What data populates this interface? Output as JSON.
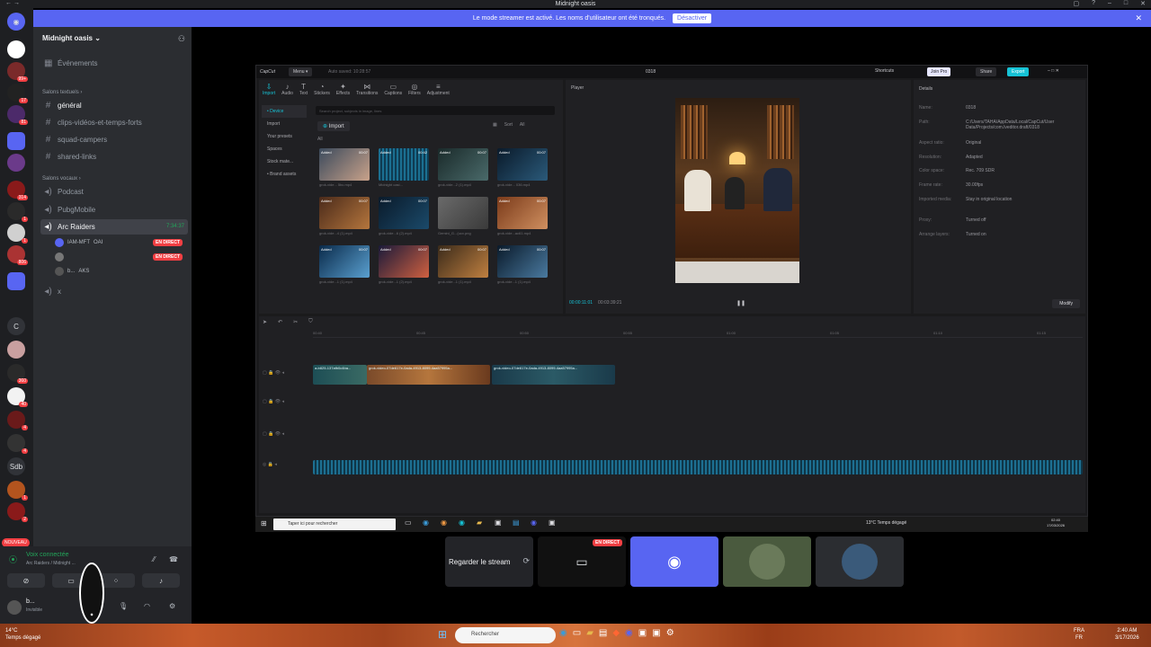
{
  "window": {
    "title": "Midnight oasis"
  },
  "banner": {
    "text": "Le mode streamer est activé. Les noms d'utilisateur ont été tronqués.",
    "button": "Désactiver"
  },
  "guilds": [
    {
      "label": "",
      "badge": ""
    },
    {
      "label": "",
      "badge": "99+"
    },
    {
      "label": "",
      "badge": "17"
    },
    {
      "label": "",
      "badge": "81"
    },
    {
      "label": "",
      "badge": ""
    },
    {
      "label": "",
      "badge": ""
    },
    {
      "label": "",
      "badge": "314"
    },
    {
      "label": "",
      "badge": "1"
    },
    {
      "label": "",
      "badge": "1"
    },
    {
      "label": "",
      "badge": "806"
    },
    {
      "label": "",
      "badge": ""
    },
    {
      "label": "C",
      "badge": ""
    },
    {
      "label": "",
      "badge": ""
    },
    {
      "label": "",
      "badge": "360"
    },
    {
      "label": "",
      "badge": "40"
    },
    {
      "label": "",
      "badge": "4"
    },
    {
      "label": "",
      "badge": "4"
    },
    {
      "label": "Sdb",
      "badge": ""
    },
    {
      "label": "",
      "badge": "1"
    },
    {
      "label": "",
      "badge": "2"
    }
  ],
  "guild_new": "NOUVEAU",
  "server": {
    "name": "Midnight oasis",
    "events": "Événements",
    "text_category": "Salons textuels",
    "text_channels": [
      "général",
      "clips-vidéos-et-temps-forts",
      "squad-campers",
      "shared-links"
    ],
    "voice_category": "Salons vocaux",
    "voice_channels": [
      "Podcast",
      "PubgMobile",
      "Arc Raiders",
      "x"
    ],
    "arc_timer": "7:34:37",
    "voice_users": [
      {
        "name": "IAM-MFT",
        "tag": "OAI",
        "live": "EN DIRECT"
      },
      {
        "name": "",
        "tag": "",
        "live": "EN DIRECT"
      },
      {
        "name": "b...",
        "tag": "AKS",
        "live": ""
      }
    ]
  },
  "voice_panel": {
    "status": "Voix connectée",
    "sub": "Arc Raiders / Midnight ...",
    "user": "b...",
    "user_status": "Invisible"
  },
  "capcut": {
    "logo": "CapCut",
    "menu": "Menu",
    "autosave": "Auto saved: 10:28:57",
    "project": "0318",
    "shortcuts": "Shortcuts",
    "join_pro": "Join Pro",
    "share": "Share",
    "export": "Export",
    "tools": [
      "Import",
      "Audio",
      "Text",
      "Stickers",
      "Effects",
      "Transitions",
      "Captions",
      "Filters",
      "Adjustment"
    ],
    "side": [
      "• Device",
      "Import",
      "Your presets",
      "Spaces",
      "Stock mate...",
      "• Brand assets"
    ],
    "search_placeholder": "Search project, subjects in image, lines",
    "import_btn": "Import",
    "all": "All",
    "sort": "Sort",
    "all2": "All",
    "thumbs": [
      {
        "tag": "Added",
        "dur": "00:07",
        "cap": "grok-vide... 5bc.mp4"
      },
      {
        "tag": "Added",
        "dur": "00:42",
        "cap": "Midnight oasi..."
      },
      {
        "tag": "Added",
        "dur": "00:07",
        "cap": "grok-vide...2 (1).mp4"
      },
      {
        "tag": "Added",
        "dur": "00:07",
        "cap": "grok-vide... 036.mp4"
      },
      {
        "tag": "Added",
        "dur": "00:07",
        "cap": "grok-vide...4 (1).mp4"
      },
      {
        "tag": "Added",
        "dur": "00:07",
        "cap": "grok-vide...6 (2).mp4"
      },
      {
        "tag": "",
        "dur": "",
        "cap": "Gemini_G...(ucx.png"
      },
      {
        "tag": "Added",
        "dur": "00:07",
        "cap": "grok-vide...ac61.mp4"
      },
      {
        "tag": "Added",
        "dur": "00:07",
        "cap": "grok-vide...1 (1).mp4"
      },
      {
        "tag": "Added",
        "dur": "00:07",
        "cap": "grok-vide...1 (2).mp4"
      },
      {
        "tag": "Added",
        "dur": "00:07",
        "cap": "grok-vide...1 (1).mp4"
      },
      {
        "tag": "Added",
        "dur": "00:07",
        "cap": "grok-vide...1 (1).mp4"
      }
    ],
    "player_title": "Player",
    "time_current": "00:00:11:01",
    "time_total": "00:03:39:21",
    "details_title": "Details",
    "details": [
      {
        "k": "Name:",
        "v": "0318"
      },
      {
        "k": "Path:",
        "v": "C:/Users/TAHA/AppData/Local/CapCut/User Data/Projects/com.lveditor.draft/0318"
      },
      {
        "k": "Aspect ratio:",
        "v": "Original"
      },
      {
        "k": "Resolution:",
        "v": "Adapted"
      },
      {
        "k": "Color space:",
        "v": "Rec. 709 SDR"
      },
      {
        "k": "Frame rate:",
        "v": "30.00fps"
      },
      {
        "k": "Imported media:",
        "v": "Stay in original location"
      },
      {
        "k": "Proxy:",
        "v": "Turned off"
      },
      {
        "k": "Arrange layers:",
        "v": "Turned on"
      }
    ],
    "modify": "Modify",
    "ruler": [
      "00:40",
      "00:45",
      "00:50",
      "00:55",
      "01:00",
      "01:05",
      "01:10",
      "01:15"
    ],
    "clips": [
      "a-b825-137afb0c4ba...",
      "grok-video-07de617e-0ada-4913-8099-4aa57995a...",
      "grok-video-07de617e-0ada-4913-8099-4aa57995a..."
    ]
  },
  "inner_taskbar": {
    "search": "Taper ici pour rechercher",
    "weather": "13°C  Temps dégagé",
    "time": "02:40",
    "date": "17/03/2026"
  },
  "tiles": {
    "watch": "Regarder le stream",
    "live": "EN DIRECT"
  },
  "taskbar": {
    "weather_temp": "14°C",
    "weather_text": "Temps dégagé",
    "search": "Rechercher",
    "lang1": "FRA",
    "lang2": "FR",
    "time": "2:40 AM",
    "date": "3/17/2026"
  },
  "colors": {
    "discord_blurple": "#5865f2",
    "live_red": "#f23f43",
    "voice_green": "#23a55a",
    "capcut_accent": "#16c2d5"
  }
}
